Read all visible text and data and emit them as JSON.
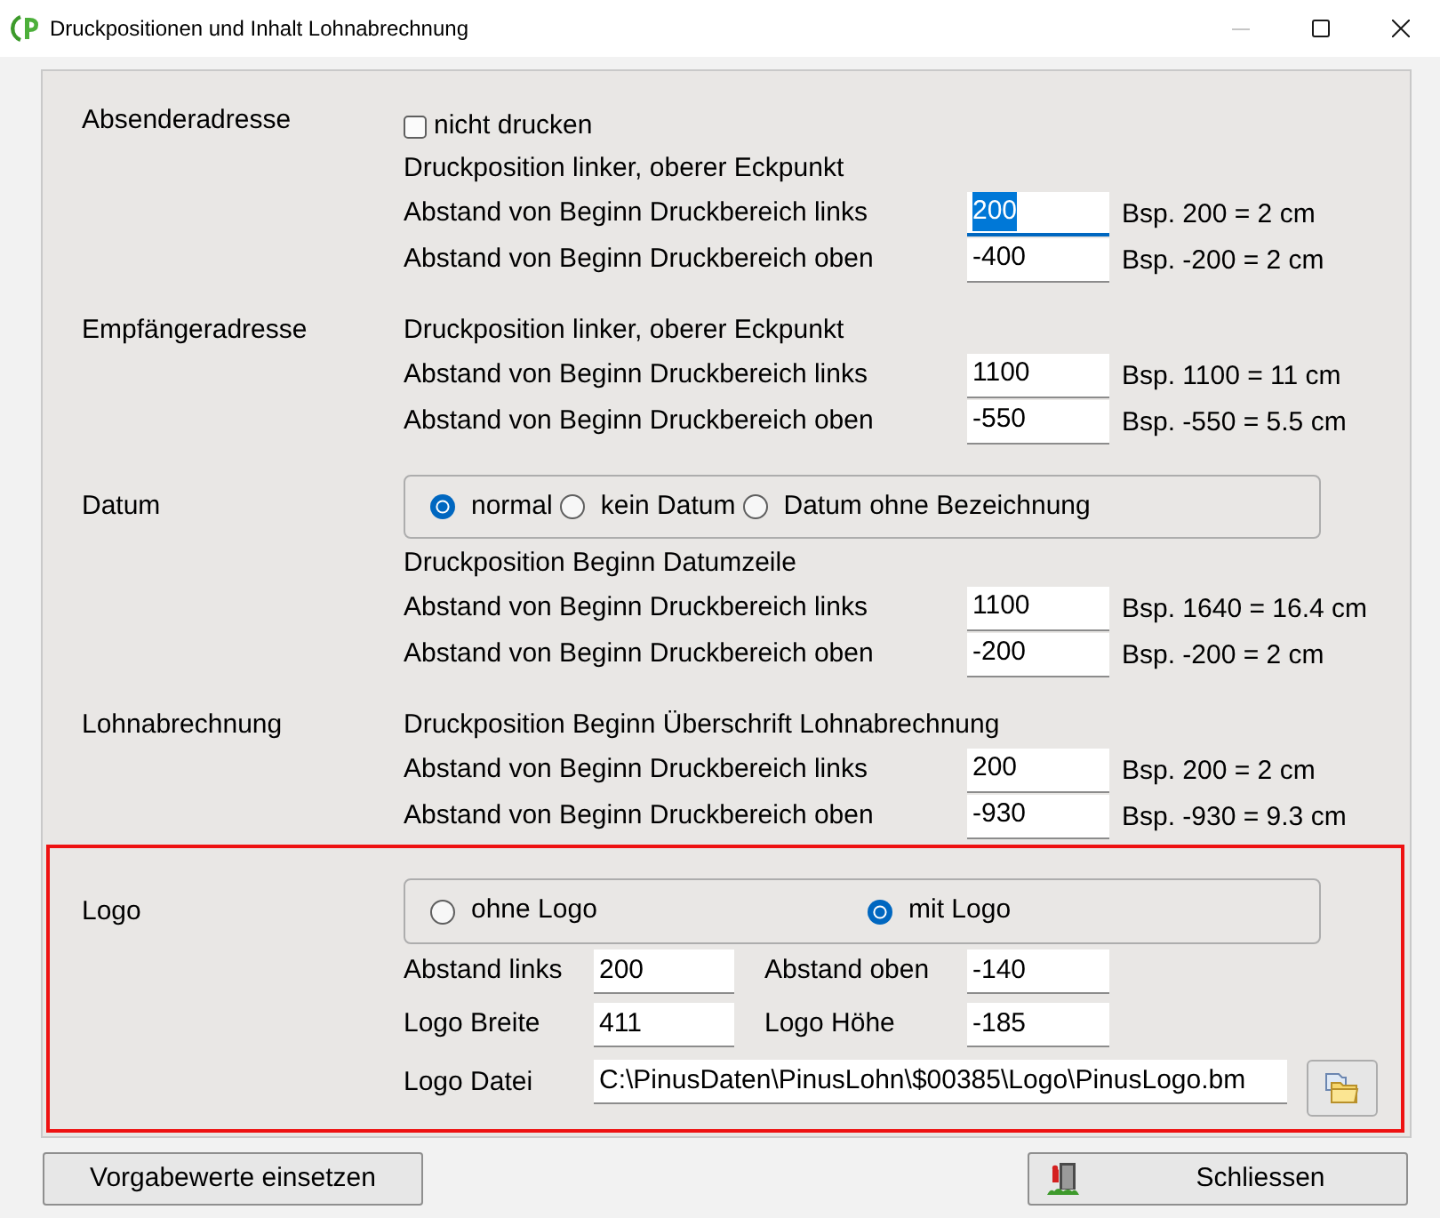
{
  "window": {
    "title": "Druckpositionen und Inhalt Lohnabrechnung",
    "controls": [
      {
        "kind": "minimize",
        "disabled": true
      },
      {
        "kind": "maximize",
        "disabled": false
      },
      {
        "kind": "close",
        "disabled": false
      }
    ]
  },
  "sections": [
    {
      "label": "Absenderadresse",
      "checkbox": {
        "label": "nicht drucken",
        "checked": false
      },
      "heading": "Druckposition linker, oberer Eckpunkt",
      "fields": [
        {
          "label": "Abstand von Beginn Druckbereich links",
          "value": "200",
          "focused": true,
          "example": "Bsp. 200 = 2 cm"
        },
        {
          "label": "Abstand von Beginn Druckbereich oben",
          "value": "-400",
          "focused": false,
          "example": "Bsp. -200 = 2 cm"
        }
      ]
    },
    {
      "label": "Empfängeradresse",
      "heading": "Druckposition linker, oberer Eckpunkt",
      "fields": [
        {
          "label": "Abstand von Beginn Druckbereich links",
          "value": "1100",
          "focused": false,
          "example": "Bsp. 1100 = 11 cm"
        },
        {
          "label": "Abstand von Beginn Druckbereich oben",
          "value": "-550",
          "focused": false,
          "example": "Bsp. -550 = 5.5 cm"
        }
      ]
    },
    {
      "label": "Datum",
      "radios": [
        {
          "label": "normal",
          "selected": true
        },
        {
          "label": "kein Datum",
          "selected": false
        },
        {
          "label": "Datum ohne Bezeichnung",
          "selected": false
        }
      ],
      "heading": "Druckposition Beginn Datumzeile",
      "fields": [
        {
          "label": "Abstand von Beginn Druckbereich links",
          "value": "1100",
          "focused": false,
          "example": "Bsp. 1640 = 16.4 cm"
        },
        {
          "label": "Abstand von Beginn Druckbereich oben",
          "value": "-200",
          "focused": false,
          "example": "Bsp. -200 = 2 cm"
        }
      ]
    },
    {
      "label": "Lohnabrechnung",
      "heading": "Druckposition Beginn Überschrift Lohnabrechnung",
      "fields": [
        {
          "label": "Abstand von Beginn Druckbereich links",
          "value": "200",
          "focused": false,
          "example": "Bsp. 200 = 2 cm"
        },
        {
          "label": "Abstand von Beginn Druckbereich oben",
          "value": "-930",
          "focused": false,
          "example": "Bsp. -930 = 9.3 cm"
        }
      ]
    }
  ],
  "logo": {
    "label": "Logo",
    "highlighted": true,
    "radios": [
      {
        "label": "ohne Logo",
        "selected": false
      },
      {
        "label": "mit Logo",
        "selected": true
      }
    ],
    "fields": [
      {
        "label": "Abstand links",
        "value": "200"
      },
      {
        "label": "Abstand oben",
        "value": "-140"
      },
      {
        "label": "Logo Breite",
        "value": "411"
      },
      {
        "label": "Logo Höhe",
        "value": "-185"
      }
    ],
    "file": {
      "label": "Logo Datei",
      "value": "C:\\PinusDaten\\PinusLohn\\$00385\\Logo\\PinusLogo.bm"
    }
  },
  "buttons": [
    {
      "kind": "default",
      "label": "Vorgabewerte einsetzen"
    },
    {
      "kind": "exit",
      "label": "Schliessen"
    }
  ]
}
